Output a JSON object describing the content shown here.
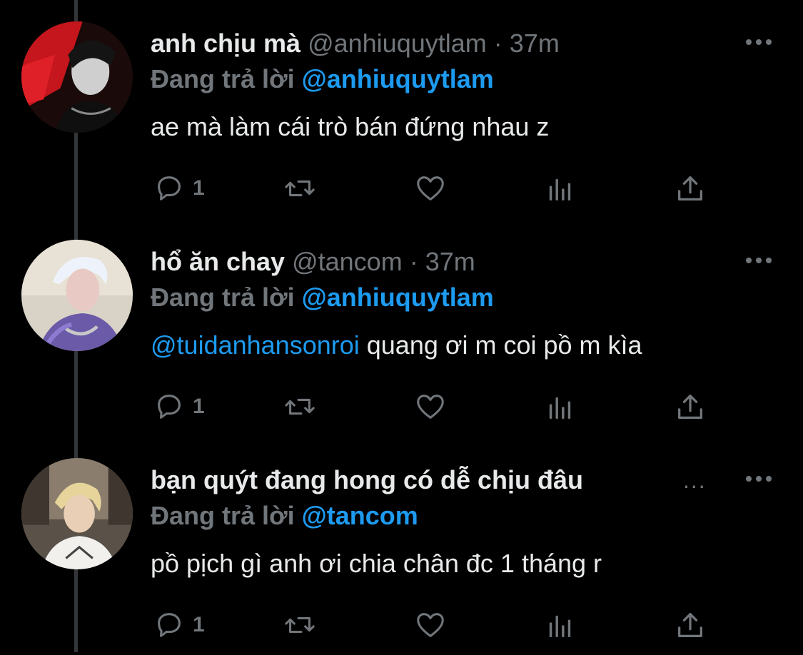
{
  "colors": {
    "background": "#000000",
    "text": "#e7e9ea",
    "muted": "#71767b",
    "link": "#1d9bf0",
    "thread_line": "#333639"
  },
  "tweets": [
    {
      "name": "anh chịu mà",
      "handle": "@anhiuquytlam",
      "separator": "·",
      "time": "37m",
      "name_truncated": "",
      "reply_label": "Đang trả lời",
      "reply_to": "@anhiuquytlam",
      "mention": "",
      "text": "ae mà làm cái trò bán đứng nhau z",
      "reply_count": "1",
      "icons": [
        "reply-icon",
        "retweet-icon",
        "like-icon",
        "views-icon",
        "share-icon",
        "more-icon"
      ]
    },
    {
      "name": "hổ ăn chay",
      "handle": "@tancom",
      "separator": "·",
      "time": "37m",
      "name_truncated": "",
      "reply_label": "Đang trả lời",
      "reply_to": "@anhiuquytlam",
      "mention": "@tuidanhansonroi",
      "text": " quang ơi m coi pồ m kìa",
      "reply_count": "1",
      "icons": [
        "reply-icon",
        "retweet-icon",
        "like-icon",
        "views-icon",
        "share-icon",
        "more-icon"
      ]
    },
    {
      "name": "bạn quýt đang hong có dễ chịu đâu",
      "handle": "",
      "separator": "",
      "time": "",
      "name_truncated": "...",
      "reply_label": "Đang trả lời",
      "reply_to": "@tancom",
      "mention": "",
      "text": "pồ pịch gì anh ơi chia chân đc 1 tháng r",
      "reply_count": "1",
      "icons": [
        "reply-icon",
        "retweet-icon",
        "like-icon",
        "views-icon",
        "share-icon",
        "more-icon"
      ]
    }
  ]
}
